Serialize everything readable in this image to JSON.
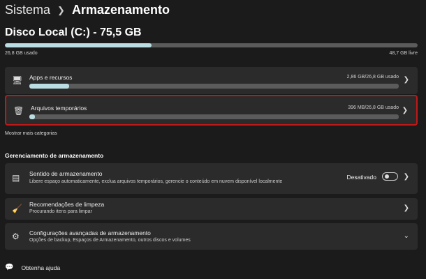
{
  "breadcrumb": {
    "parent": "Sistema",
    "current": "Armazenamento"
  },
  "disk": {
    "title": "Disco Local (C:) - 75,5 GB",
    "used": "26,8 GB usado",
    "free": "48,7 GB livre",
    "used_fraction": 0.355
  },
  "categories": [
    {
      "label": "Apps e recursos",
      "usage": "2,86 GB/26,8 GB usado",
      "fraction": 0.107,
      "icon": "apps-icon"
    },
    {
      "label": "Arquivos temporários",
      "usage": "396 MB/26,8 GB usado",
      "fraction": 0.014,
      "icon": "trash-icon"
    }
  ],
  "show_more": "Mostrar mais categorias",
  "management": {
    "heading": "Gerenciamento de armazenamento",
    "items": [
      {
        "title": "Sentido de armazenamento",
        "subtitle": "Libere espaço automaticamente, exclua arquivos temporários, gerencie o conteúdo em nuvem disponível localmente",
        "toggle_label": "Desativado",
        "toggle_on": false
      },
      {
        "title": "Recomendações de limpeza",
        "subtitle": "Procurando itens para limpar"
      },
      {
        "title": "Configurações avançadas de armazenamento",
        "subtitle": "Opções de backup, Espaços de Armazenamento, outros discos e volumes"
      }
    ]
  },
  "help": "Obtenha ajuda",
  "colors": {
    "bar_fill": "#b9dde2",
    "highlight": "#c01818"
  }
}
